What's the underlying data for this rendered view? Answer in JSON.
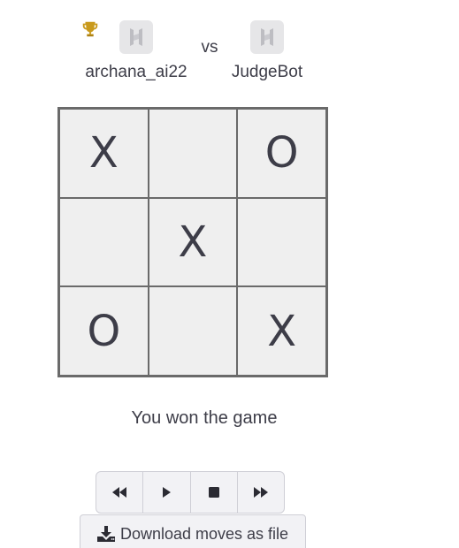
{
  "players": {
    "left": {
      "name": "archana_ai22",
      "winner": true,
      "avatar_icon": "hex-logo-icon"
    },
    "right": {
      "name": "JudgeBot",
      "winner": false,
      "avatar_icon": "hex-logo-icon"
    },
    "vs_label": "vs"
  },
  "board": {
    "cells": [
      "X",
      "",
      "O",
      "",
      "X",
      "",
      "O",
      "",
      "X"
    ]
  },
  "status": "You won the game",
  "controls": {
    "icons": [
      "rewind-icon",
      "play-icon",
      "stop-icon",
      "fast-forward-icon"
    ]
  },
  "download": {
    "label": "Download moves as file",
    "icon": "download-icon"
  },
  "colors": {
    "trophy": "#c99a1c",
    "text": "#3d3d48",
    "board_bg": "#efefef",
    "grid_line": "#6a6a6a"
  }
}
